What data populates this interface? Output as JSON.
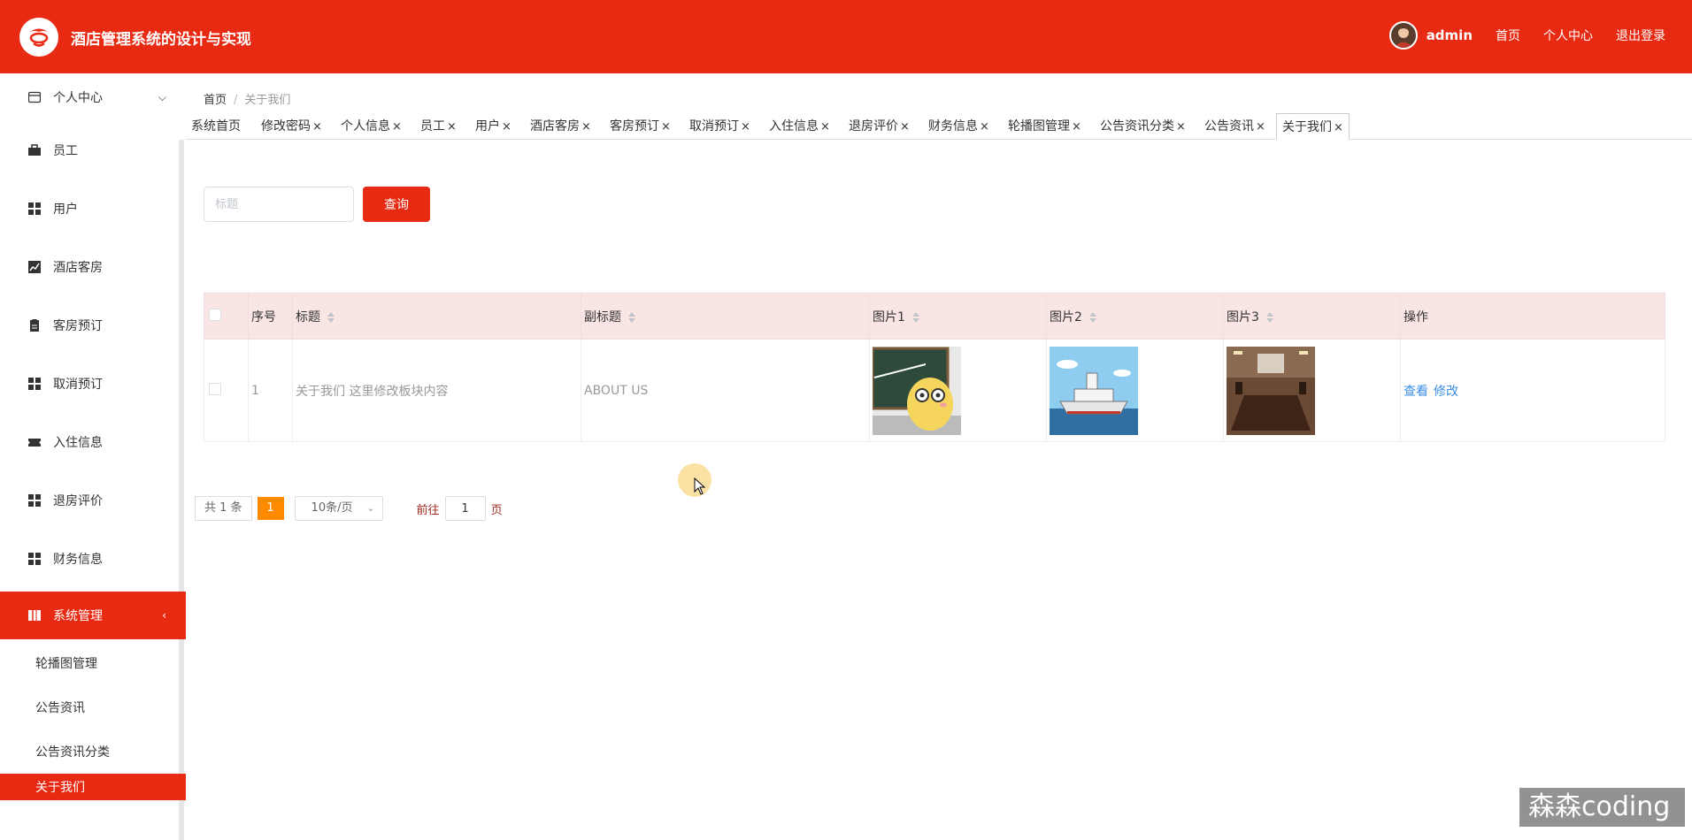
{
  "header": {
    "app_title": "酒店管理系统的设计与实现",
    "user_name": "admin",
    "links": [
      "首页",
      "个人中心",
      "退出登录"
    ],
    "accent_color": "#e92a13"
  },
  "sidebar": {
    "items": [
      {
        "label": "个人中心",
        "icon": "card-icon"
      },
      {
        "label": "员工",
        "icon": "briefcase-icon"
      },
      {
        "label": "用户",
        "icon": "grid-icon"
      },
      {
        "label": "酒店客房",
        "icon": "chart-icon"
      },
      {
        "label": "客房预订",
        "icon": "clipboard-icon"
      },
      {
        "label": "取消预订",
        "icon": "grid-icon"
      },
      {
        "label": "入住信息",
        "icon": "ticket-icon"
      },
      {
        "label": "退房评价",
        "icon": "grid-icon"
      },
      {
        "label": "财务信息",
        "icon": "grid-icon"
      },
      {
        "label": "系统管理",
        "icon": "book-icon"
      }
    ],
    "submenu": [
      "轮播图管理",
      "公告资讯",
      "公告资讯分类",
      "关于我们"
    ]
  },
  "breadcrumb": {
    "home": "首页",
    "separator": "/",
    "current": "关于我们"
  },
  "tabs": [
    "系统首页",
    "修改密码",
    "个人信息",
    "员工",
    "用户",
    "酒店客房",
    "客房预订",
    "取消预订",
    "入住信息",
    "退房评价",
    "财务信息",
    "轮播图管理",
    "公告资讯分类",
    "公告资讯",
    "关于我们"
  ],
  "tab_close": "×",
  "search": {
    "placeholder": "标题",
    "button_label": "查询"
  },
  "table": {
    "headers": [
      "序号",
      "标题",
      "副标题",
      "图片1",
      "图片2",
      "图片3",
      "操作"
    ],
    "rows": [
      {
        "index": "1",
        "title": "关于我们 这里修改板块内容",
        "subtitle": "ABOUT US",
        "actions": [
          "查看",
          "修改"
        ]
      }
    ]
  },
  "pagination": {
    "total": "共 1 条",
    "current_page": "1",
    "page_size": "10条/页",
    "goto_label": "前往",
    "goto_value": "1",
    "goto_suffix": "页"
  },
  "watermark": "森森coding"
}
